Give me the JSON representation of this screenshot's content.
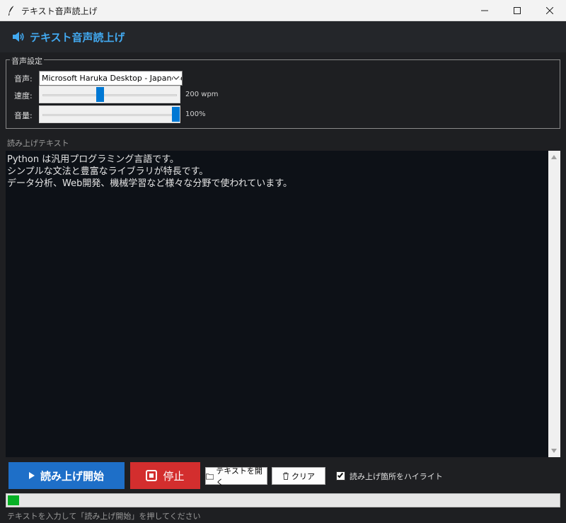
{
  "window": {
    "title": "テキスト音声読上げ",
    "icons": {
      "app": "feather-icon",
      "minimize": "minimize-icon",
      "maximize": "maximize-icon",
      "close": "close-icon"
    }
  },
  "header": {
    "title": "テキスト音声読上げ",
    "icon": "speaker-icon",
    "title_color": "#42a9f0"
  },
  "settings": {
    "legend": "音声設定",
    "voice_label": "音声:",
    "voice_value": "Microsoft Haruka Desktop - Japanese",
    "speed_label": "速度:",
    "speed_value_text": "200 wpm",
    "speed_fraction": 0.43,
    "volume_label": "音量:",
    "volume_value_text": "100%",
    "volume_fraction": 1.0
  },
  "editor": {
    "label": "読み上げテキスト",
    "text": "Python は汎用プログラミング言語です。\nシンプルな文法と豊富なライブラリが特長です。\nデータ分析、Web開発、機械学習など様々な分野で使われています。"
  },
  "actions": {
    "start_label": "読み上げ開始",
    "start_icon": "play-icon",
    "stop_label": "停止",
    "stop_icon": "stop-icon",
    "open_label": "テキストを開く",
    "open_icon": "folder-icon",
    "clear_label": "クリア",
    "clear_icon": "trash-icon",
    "highlight_label": "読み上げ箇所をハイライト",
    "highlight_checked": true
  },
  "progress": {
    "fraction": 0.02,
    "color": "#06b025"
  },
  "status": {
    "text": "テキストを入力して「読み上げ開始」を押してください"
  },
  "colors": {
    "start": "#1e6fc8",
    "stop": "#d32e2e",
    "accent": "#0078d4"
  }
}
